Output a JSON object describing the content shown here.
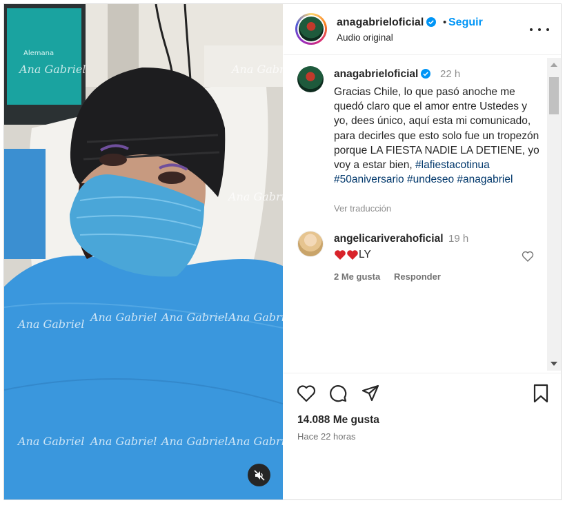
{
  "post": {
    "username": "anagabrieloficial",
    "separator": "•",
    "follow_label": "Seguir",
    "subtitle": "Audio original",
    "more_label": "More options"
  },
  "caption": {
    "username": "anagabrieloficial",
    "time": "22 h",
    "text": "Gracias Chile, lo que pasó anoche me quedó claro que el amor entre Ustedes y yo, dees único, aquí esta mi comunicado, para decirles que esto solo fue un tropezón porque LA FIESTA NADIE LA DETIENE, yo voy a estar bien, ",
    "hashtags": [
      "#lafiestacotinua",
      "#50aniversario",
      "#undeseo",
      "#anagabriel"
    ],
    "see_translation": "Ver traducción"
  },
  "comments": [
    {
      "username": "angelicariverahoficial",
      "time": "19 h",
      "text": "LY",
      "emoji_hearts": 2,
      "likes_label": "2 Me gusta",
      "reply_label": "Responder"
    }
  ],
  "footer": {
    "likes": "14.088 Me gusta",
    "posted": "Hace 22 horas"
  },
  "media": {
    "watermark": "Ana Gabriel",
    "monitor_text": "Alemana"
  },
  "colors": {
    "accent": "#0095f6",
    "verified": "#0095f6",
    "hashtag": "#00376b",
    "heart_emoji": "#d8232a"
  },
  "icons": [
    "heart-icon",
    "comment-icon",
    "share-icon",
    "bookmark-icon",
    "mute-icon",
    "verified-icon"
  ]
}
